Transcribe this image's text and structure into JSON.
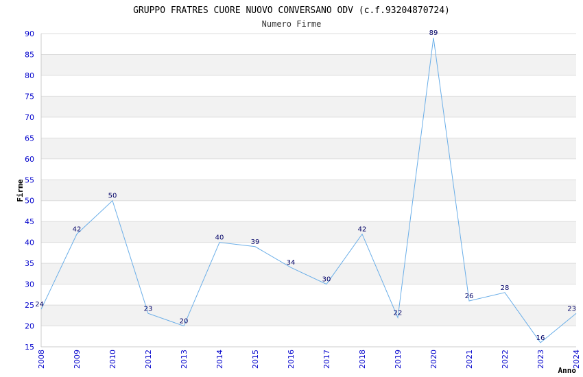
{
  "chart_data": {
    "type": "line",
    "title": "GRUPPO FRATRES CUORE NUOVO CONVERSANO ODV (c.f.93204870724)",
    "subtitle": "Numero Firme",
    "xlabel": "Anno",
    "ylabel": "Firme",
    "ylim": [
      15,
      90
    ],
    "yticks": [
      15,
      20,
      25,
      30,
      35,
      40,
      45,
      50,
      55,
      60,
      65,
      70,
      75,
      80,
      85,
      90
    ],
    "grid": true,
    "categories": [
      "2008",
      "2009",
      "2010",
      "2012",
      "2013",
      "2014",
      "2015",
      "2016",
      "2017",
      "2018",
      "2019",
      "2020",
      "2021",
      "2022",
      "2023",
      "2024"
    ],
    "series": [
      {
        "values": [
          24,
          42,
          50,
          23,
          20,
          40,
          39,
          34,
          30,
          42,
          22,
          89,
          26,
          28,
          16,
          23
        ]
      }
    ],
    "colors": {
      "line": "#6aaee8",
      "band": "#f2f2f2",
      "tick": "#0000cc",
      "data_label": "#000066"
    }
  }
}
